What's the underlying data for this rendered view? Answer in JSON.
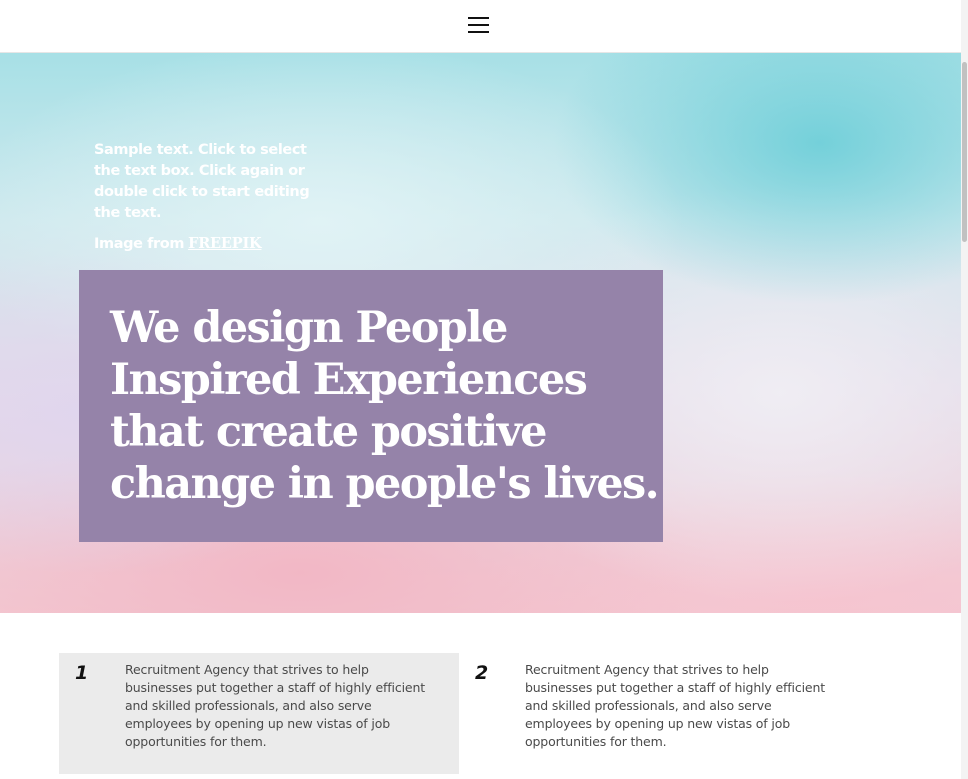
{
  "header": {
    "menu_icon": "hamburger-menu-icon"
  },
  "hero": {
    "sample_text": "Sample text. Click to select the text box. Click again or double click to start editing the text.",
    "image_credit_prefix": "Image from",
    "image_credit_link": "FREEPIK",
    "headline": "We design People\nInspired Experiences\nthat create positive\nchange in people's lives.",
    "colors": {
      "headline_box": "#9583a9",
      "sky_top": "#a7e0e6",
      "sky_bottom": "#f3c9d2"
    }
  },
  "features": {
    "items": [
      {
        "number": "1",
        "text": "Recruitment Agency that strives to help businesses put together a staff of highly efficient and skilled professionals, and also serve employees by opening up new vistas of job opportunities for them."
      },
      {
        "number": "2",
        "text": "Recruitment Agency that strives to help businesses put together a staff of highly efficient and skilled professionals, and also serve employees by opening up new vistas of job opportunities for them."
      }
    ],
    "colors": {
      "card_highlight": "#ebebeb"
    }
  }
}
